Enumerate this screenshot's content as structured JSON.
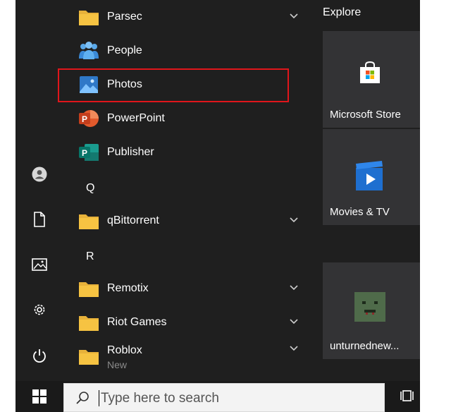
{
  "list": {
    "apps": [
      {
        "label": "Parsec",
        "icon": "folder-icon",
        "expandable": true
      },
      {
        "label": "People",
        "icon": "people-icon",
        "expandable": false
      },
      {
        "label": "Photos",
        "icon": "photos-icon",
        "expandable": false,
        "highlighted": true
      },
      {
        "label": "PowerPoint",
        "icon": "powerpoint-icon",
        "expandable": false
      },
      {
        "label": "Publisher",
        "icon": "publisher-icon",
        "expandable": false
      },
      {
        "label": "qBittorrent",
        "icon": "folder-icon",
        "expandable": true
      },
      {
        "label": "Remotix",
        "icon": "folder-icon",
        "expandable": true
      },
      {
        "label": "Riot Games",
        "icon": "folder-icon",
        "expandable": true
      },
      {
        "label": "Roblox",
        "icon": "folder-icon",
        "expandable": true,
        "sublabel": "New"
      }
    ],
    "letters": [
      "Q",
      "R"
    ]
  },
  "tiles": {
    "group_title": "Explore",
    "items": [
      {
        "label": "Microsoft Store",
        "icon": "store-icon"
      },
      {
        "label": "Movies & TV",
        "icon": "movies-tv-icon"
      },
      {
        "label": "unturnednew...",
        "icon": "unturned-icon"
      }
    ]
  },
  "rail": {
    "icons": [
      "user-account-icon",
      "documents-icon",
      "pictures-icon",
      "settings-icon",
      "power-icon"
    ]
  },
  "taskbar": {
    "search_placeholder": "Type here to search"
  },
  "colors": {
    "highlight": "#e0161b",
    "panel_bg": "#1f1f1f",
    "tile_bg": "#333335",
    "folder": "#f6c342"
  }
}
